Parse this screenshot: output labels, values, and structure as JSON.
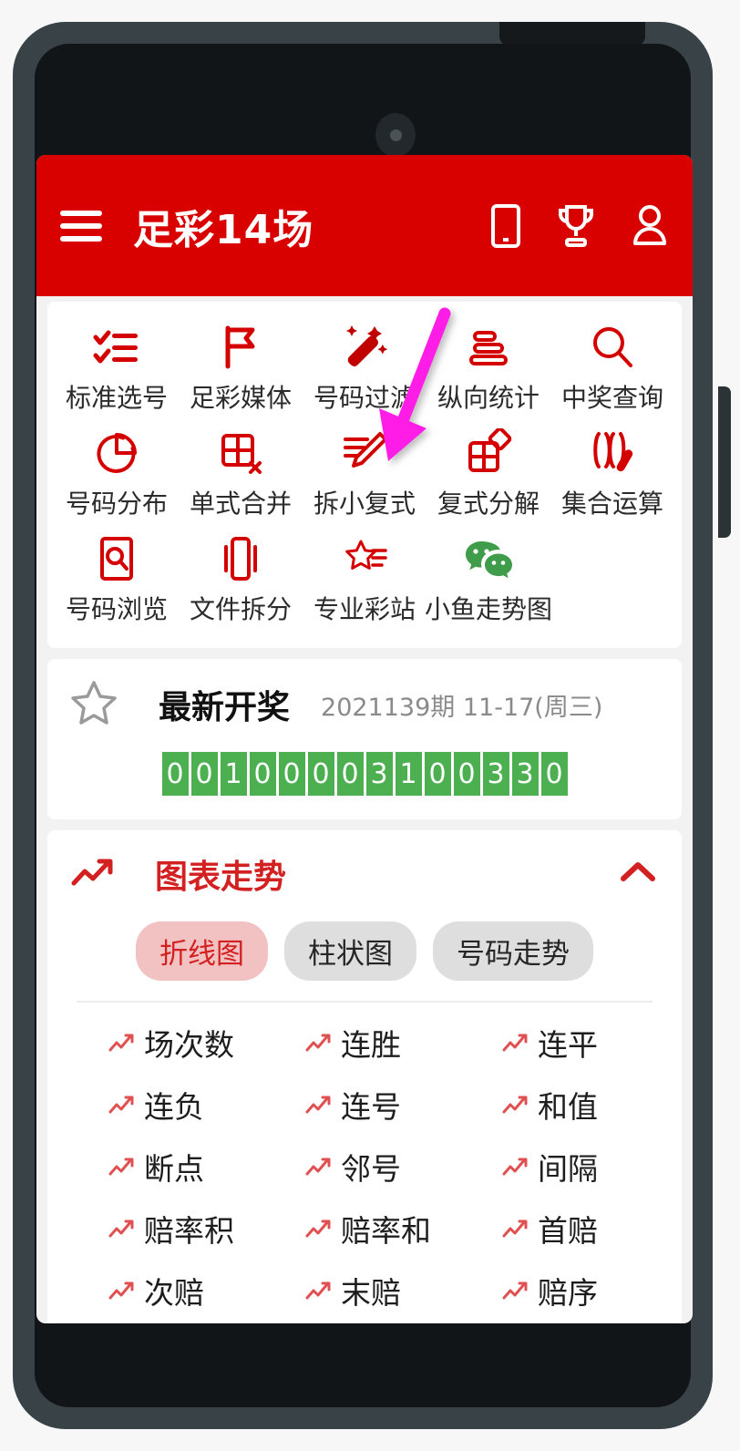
{
  "header": {
    "menu_icon": "hamburger-menu-icon",
    "title": "足彩14场",
    "actions": [
      {
        "icon": "mobile-device-icon",
        "name": "mobile"
      },
      {
        "icon": "trophy-icon",
        "name": "trophy"
      },
      {
        "icon": "user-account-icon",
        "name": "account"
      }
    ],
    "bg_color": "#d90000"
  },
  "grid": {
    "rows": [
      [
        {
          "icon": "checklist-icon",
          "label": "标准选号",
          "color": "#d40000"
        },
        {
          "icon": "flag-icon",
          "label": "足彩媒体",
          "color": "#d40000"
        },
        {
          "icon": "magic-wand-icon",
          "label": "号码过滤",
          "color": "#c00000"
        },
        {
          "icon": "bar-chart-horizontal-icon",
          "label": "纵向统计",
          "color": "#d40000"
        },
        {
          "icon": "search-icon",
          "label": "中奖查询",
          "color": "#d40000"
        }
      ],
      [
        {
          "icon": "pie-chart-icon",
          "label": "号码分布",
          "color": "#d40000"
        },
        {
          "icon": "grid-remove-icon",
          "label": "单式合并",
          "color": "#d40000"
        },
        {
          "icon": "pencil-edit-icon",
          "label": "拆小复式",
          "color": "#d40000"
        },
        {
          "icon": "grid-decompose-icon",
          "label": "复式分解",
          "color": "#d40000"
        },
        {
          "icon": "set-operation-icon",
          "label": "集合运算",
          "color": "#d40000"
        }
      ],
      [
        {
          "icon": "document-search-icon",
          "label": "号码浏览",
          "color": "#d40000"
        },
        {
          "icon": "file-split-icon",
          "label": "文件拆分",
          "color": "#d40000"
        },
        {
          "icon": "star-list-icon",
          "label": "专业彩站",
          "color": "#d40000"
        },
        {
          "icon": "wechat-icon",
          "label": "小鱼走势图",
          "color": "#3f9c4a"
        }
      ]
    ]
  },
  "latest_draw": {
    "star_icon": "star-outline-icon",
    "title": "最新开奖",
    "issue": "2021139期  11-17(周三)",
    "numbers": [
      "0",
      "0",
      "1",
      "0",
      "0",
      "0",
      "0",
      "3",
      "1",
      "0",
      "0",
      "3",
      "3",
      "0"
    ],
    "ball_color": "#4caf50"
  },
  "chart_section": {
    "trend_icon": "trending-up-icon",
    "title": "图表走势",
    "collapse_icon": "chevron-up-icon",
    "accent_color": "#d32020",
    "chips": [
      {
        "label": "折线图",
        "active": true
      },
      {
        "label": "柱状图",
        "active": false
      },
      {
        "label": "号码走势",
        "active": false
      }
    ],
    "metrics": [
      [
        {
          "label": "场次数"
        },
        {
          "label": "连胜"
        },
        {
          "label": "连平"
        }
      ],
      [
        {
          "label": "连负"
        },
        {
          "label": "连号"
        },
        {
          "label": "和值"
        }
      ],
      [
        {
          "label": "断点"
        },
        {
          "label": "邻号"
        },
        {
          "label": "间隔"
        }
      ],
      [
        {
          "label": "赔率积"
        },
        {
          "label": "赔率和"
        },
        {
          "label": "首赔"
        }
      ],
      [
        {
          "label": "次赔"
        },
        {
          "label": "末赔"
        },
        {
          "label": "赔序"
        }
      ]
    ],
    "metric_icon": "trending-up-small-icon"
  },
  "annotation": {
    "arrow_color": "#ff1ae6",
    "points_to": "拆小复式"
  }
}
